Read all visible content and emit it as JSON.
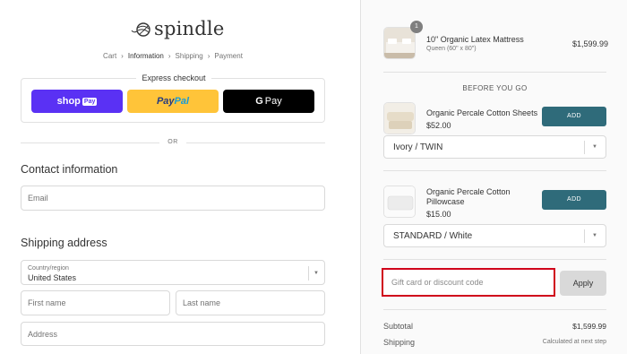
{
  "brand": {
    "name": "spindle"
  },
  "breadcrumbs": [
    "Cart",
    "Information",
    "Shipping",
    "Payment"
  ],
  "express": {
    "title": "Express checkout",
    "shop_pay": {
      "shop": "shop",
      "pay": "Pay"
    },
    "paypal": {
      "a": "Pay",
      "b": "Pal"
    },
    "gpay": {
      "g": "G",
      "pay": "Pay"
    }
  },
  "or_label": "OR",
  "contact": {
    "heading": "Contact information",
    "email_placeholder": "Email"
  },
  "shipping": {
    "heading": "Shipping address",
    "country_label": "Country/region",
    "country_value": "United States",
    "first_name_placeholder": "First name",
    "last_name_placeholder": "Last name",
    "address_placeholder": "Address"
  },
  "order": {
    "item": {
      "quantity": "1",
      "name": "10\" Organic Latex Mattress",
      "variant": "Queen (60\" x 80\")",
      "price": "$1,599.99"
    },
    "upsell_heading": "BEFORE YOU GO",
    "upsells": [
      {
        "name": "Organic Percale Cotton Sheets",
        "price": "$52.00",
        "add_label": "ADD",
        "variant": "Ivory / TWIN"
      },
      {
        "name_line1": "Organic Percale Cotton",
        "name_line2": "Pillowcase",
        "price": "$15.00",
        "add_label": "ADD",
        "variant": "STANDARD / White"
      }
    ],
    "discount_placeholder": "Gift card or discount code",
    "apply_label": "Apply",
    "subtotal_label": "Subtotal",
    "subtotal_value": "$1,599.99",
    "shipping_label": "Shipping",
    "shipping_value": "Calculated at next step"
  },
  "colors": {
    "shop_pay": "#5a31f4",
    "paypal": "#ffc439",
    "gpay": "#000000",
    "add_button": "#2f6b7a",
    "highlight": "#d0021b"
  }
}
